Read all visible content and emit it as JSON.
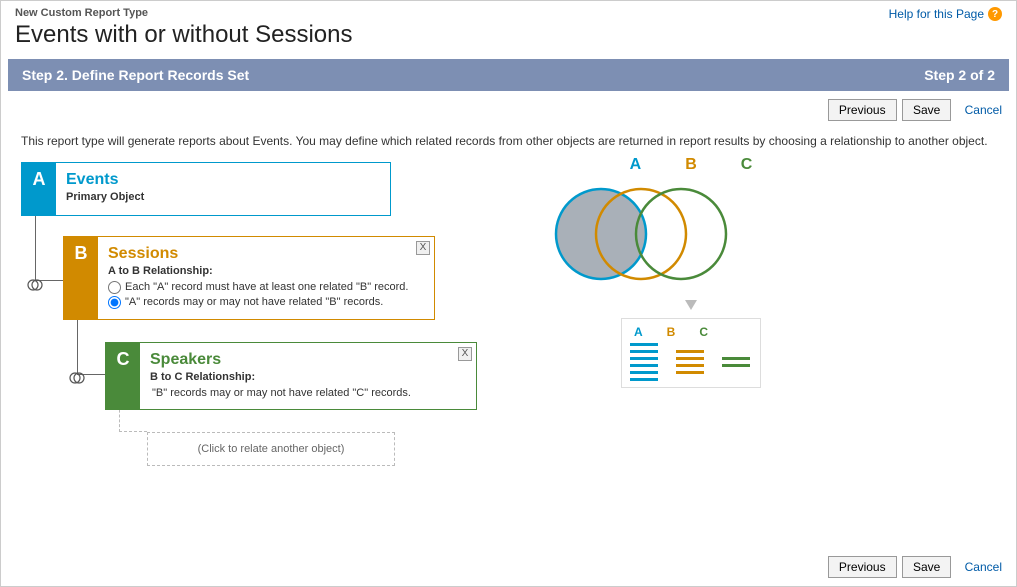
{
  "header": {
    "breadcrumb": "New Custom Report Type",
    "title": "Events with or without Sessions",
    "help": "Help for this Page",
    "help_q": "?"
  },
  "step_bar": {
    "left": "Step 2. Define Report Records Set",
    "right": "Step 2 of 2"
  },
  "buttons": {
    "previous": "Previous",
    "save": "Save",
    "cancel": "Cancel"
  },
  "intro": "This report type will generate reports about Events. You may define which related records from other objects are returned in report results by choosing a relationship to another object.",
  "boxA": {
    "letter": "A",
    "title": "Events",
    "sub": "Primary Object"
  },
  "boxB": {
    "letter": "B",
    "title": "Sessions",
    "sub": "A to B Relationship:",
    "opt1": "Each \"A\" record must have at least one related \"B\" record.",
    "opt2": "\"A\" records may or may not have related \"B\" records.",
    "close": "X"
  },
  "boxC": {
    "letter": "C",
    "title": "Speakers",
    "sub": "B to C Relationship:",
    "desc": "\"B\" records may or may not have related \"C\" records.",
    "close": "X"
  },
  "addBox": "(Click to relate another object)",
  "venn": {
    "a": "A",
    "b": "B",
    "c": "C"
  }
}
